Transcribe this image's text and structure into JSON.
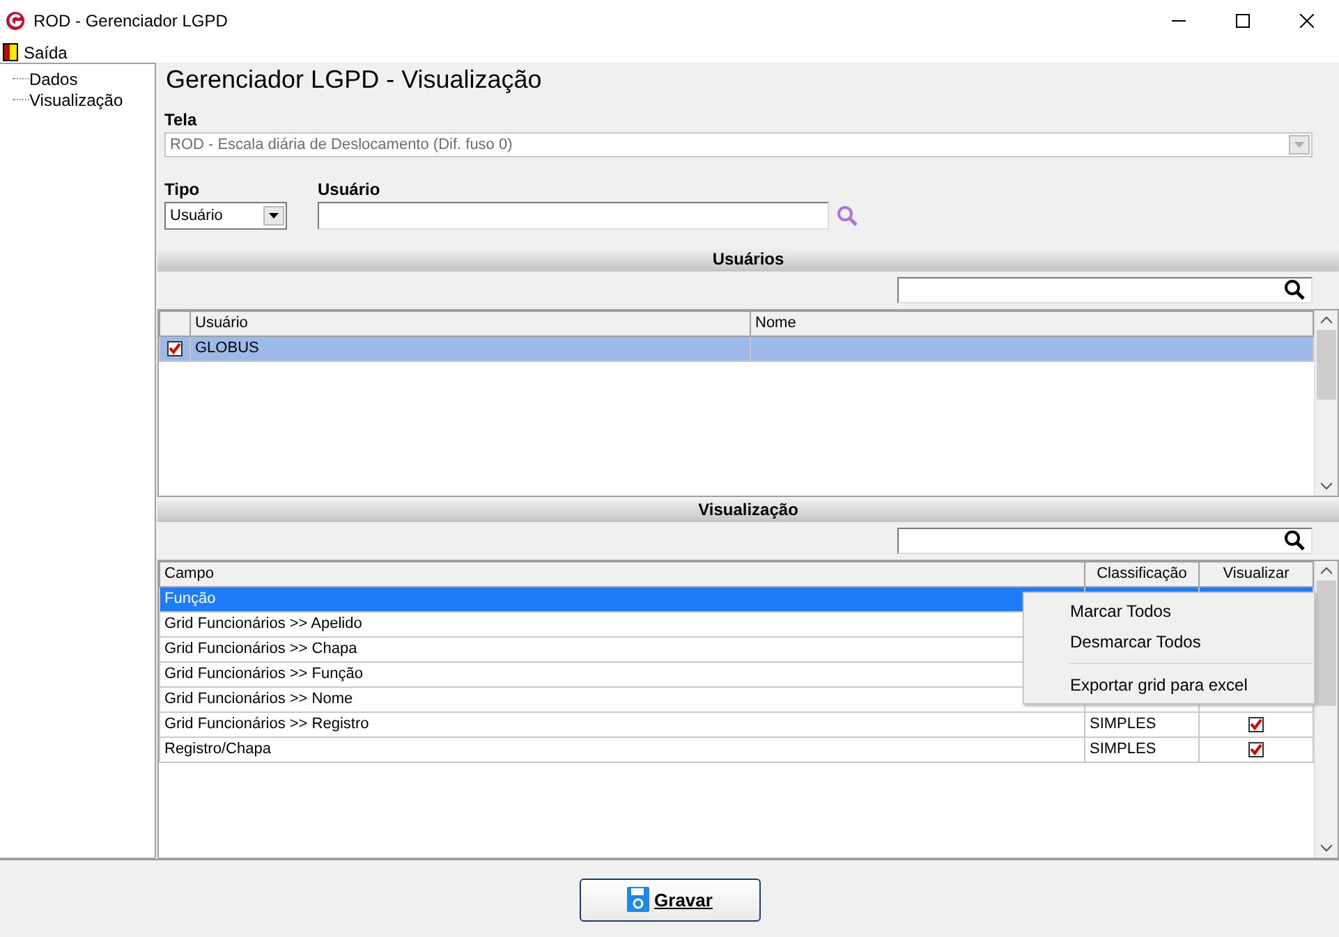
{
  "window": {
    "title": "ROD - Gerenciador LGPD"
  },
  "menu": [
    {
      "label": "Saída"
    }
  ],
  "sidebar": {
    "items": [
      {
        "label": "Dados",
        "selected": false
      },
      {
        "label": "Visualização",
        "selected": false
      }
    ]
  },
  "heading": "Gerenciador LGPD - Visualização",
  "tela": {
    "label": "Tela",
    "value": "ROD - Escala diária de Deslocamento (Dif. fuso 0)",
    "disabled": true
  },
  "tipo": {
    "label": "Tipo",
    "value": "Usuário"
  },
  "usuario": {
    "label": "Usuário"
  },
  "usuarios_section": {
    "title": "Usuários",
    "columns": [
      "Usuário",
      "Nome"
    ],
    "rows": [
      {
        "usuario": "GLOBUS",
        "checked": true,
        "selected": true
      }
    ]
  },
  "visualizacao_section": {
    "title": "Visualização",
    "columns": [
      "Campo",
      "Classificação",
      "Visualizar"
    ],
    "rows": [
      {
        "campo": "Função",
        "selected": true
      },
      {
        "campo": "Grid Funcionários >> Apelido",
        "selected": false
      },
      {
        "campo": "Grid Funcionários >> Chapa",
        "selected": false
      },
      {
        "campo": "Grid Funcionários >> Função",
        "selected": false
      },
      {
        "campo": "Grid Funcionários >> Nome",
        "selected": false
      },
      {
        "campo": "Grid Funcionários >> Registro",
        "classificacao": "SIMPLES",
        "visualizar": true,
        "selected": false
      },
      {
        "campo": "Registro/Chapa",
        "classificacao": "SIMPLES",
        "visualizar": true,
        "selected": false
      }
    ]
  },
  "context_menu": [
    {
      "label": "Marcar Todos",
      "kind": "item"
    },
    {
      "label": "Desmarcar Todos",
      "kind": "item"
    },
    {
      "kind": "separator"
    },
    {
      "label": "Exportar grid para excel",
      "kind": "item"
    }
  ],
  "save_button": {
    "label": "Gravar"
  }
}
